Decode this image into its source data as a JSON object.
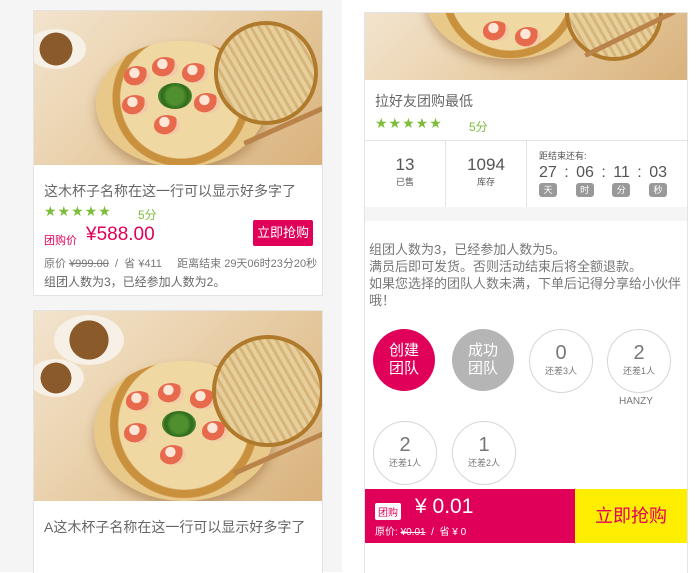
{
  "colors": {
    "accent": "#e0005a",
    "star": "#7cbd3b",
    "buy_bar": "#ffee00",
    "grey_bubble": "#b5b5b5"
  },
  "left_cards": [
    {
      "title": "这木杯子名称在这一行可以显示好多字了",
      "stars": "★★★★★",
      "score": "5分",
      "group_label": "团购价",
      "price": "¥588.00",
      "buy_label": "立即抢购",
      "original_label": "原价",
      "original_price": "¥999.00",
      "sep": "/",
      "save": "省 ¥411",
      "countdown": "距离结束 29天06时23分20秒",
      "group_info": "组团人数为3，已经参加人数为2。"
    },
    {
      "title": "A这木杯子名称在这一行可以显示好多字了"
    }
  ],
  "detail": {
    "title": "拉好友团购最低",
    "stars": "★★★★★",
    "score": "5分",
    "stats": [
      {
        "value": "13",
        "label": "已售"
      },
      {
        "value": "1094",
        "label": "库存"
      }
    ],
    "countdown_label": "距结束还有:",
    "countdown": [
      {
        "value": "27",
        "unit": "天"
      },
      {
        "value": "06",
        "unit": "时"
      },
      {
        "value": "11",
        "unit": "分"
      },
      {
        "value": "03",
        "unit": "秒"
      }
    ],
    "countdown_sep": ":",
    "description_1": "组团人数为3，已经参加人数为5。",
    "description_2": "满员后即可发货。否则活动结束后将全额退款。",
    "description_3": "如果您选择的团队人数未满，下单后记得分享给小伙伴哦！",
    "bubbles": [
      {
        "type": "filled",
        "text": "创建团队",
        "color": "#e0005a"
      },
      {
        "type": "filled",
        "text": "成功团队",
        "color": "#b5b5b5"
      },
      {
        "type": "empty",
        "num": "0",
        "label": "还差3人"
      },
      {
        "type": "empty",
        "num": "2",
        "label": "还差1人",
        "caption": "HANZY"
      },
      {
        "type": "empty",
        "num": "2",
        "label": "还差1人"
      },
      {
        "type": "empty",
        "num": "1",
        "label": "还差2人"
      }
    ],
    "bottom": {
      "group_tag": "团购",
      "price": "¥ 0.01",
      "original_label": "原价:",
      "original_price": "¥0.01",
      "sep": "/",
      "save": "省 ¥ 0",
      "buy_label": "立即抢购"
    }
  }
}
